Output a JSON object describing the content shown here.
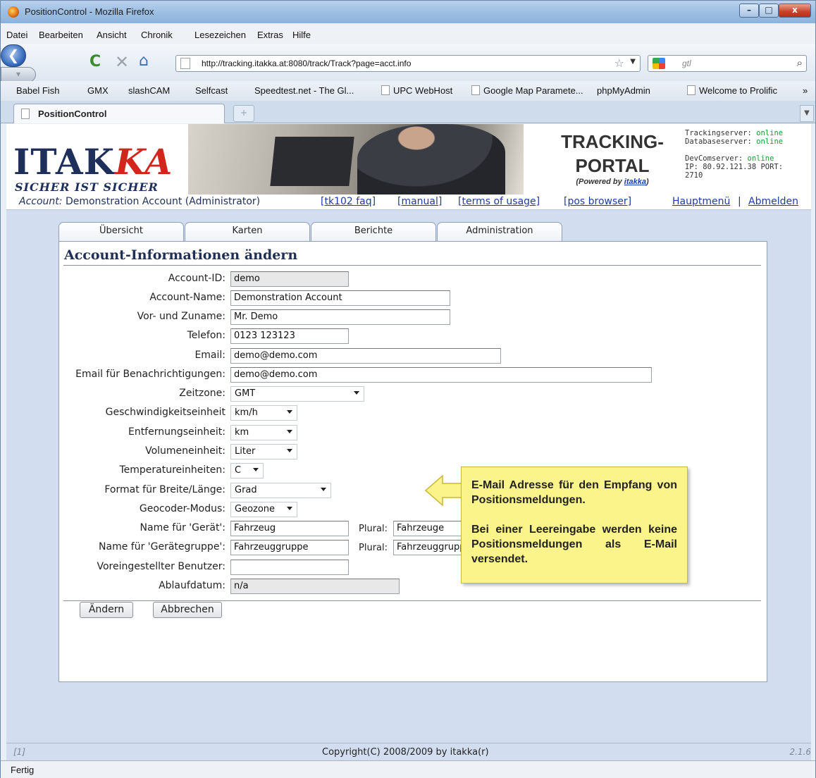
{
  "window": {
    "title": "PositionControl - Mozilla Firefox",
    "minimize_label": "–",
    "maximize_label": "□",
    "close_label": "x"
  },
  "menu": [
    "Datei",
    "Bearbeiten",
    "Ansicht",
    "Chronik",
    "Lesezeichen",
    "Extras",
    "Hilfe"
  ],
  "nav": {
    "back_glyph": "❮",
    "forward_glyph": "▾",
    "reload_glyph": "C",
    "stop_glyph": "✕",
    "home_glyph": "⌂",
    "url": "http://tracking.itakka.at:8080/track/Track?page=acct.info",
    "star_glyph": "☆",
    "search_text": "gtl"
  },
  "bookmarks": [
    "Babel Fish",
    "GMX",
    "slashCAM",
    "Selfcast",
    "Speedtest.net - The Gl...",
    "UPC WebHost",
    "Google Map Paramete...",
    "phpMyAdmin",
    "Welcome to Prolific",
    "»"
  ],
  "browser_tab": {
    "label": "PositionControl",
    "new_tab_glyph": "+"
  },
  "banner": {
    "logo_text_pre": "ITAK",
    "logo_text_red": "KA",
    "slogan": "SICHER IST SICHER",
    "portal_line1": "TRACKING-",
    "portal_line2": "PORTAL",
    "powered_prefix": "(Powered by ",
    "powered_link": "itakka",
    "powered_suffix": ")",
    "servers": {
      "tracking_label": "Trackingserver:",
      "tracking_status": "online",
      "database_label": "Databaseserver:",
      "database_status": "online",
      "devcom_label": "DevComserver:",
      "devcom_status": "online",
      "ip_line": "IP: 80.92.121.38 PORT:",
      "port": "2710"
    }
  },
  "account_bar": {
    "prefix": "Account:",
    "account": " Demonstration Account (Administrator)",
    "links": [
      "[tk102 faq]",
      "[manual]",
      "[terms of usage]",
      "[pos browser]"
    ],
    "main_menu": "Hauptmenü",
    "separator": "|",
    "logout": "Abmelden"
  },
  "tabs": [
    "Übersicht",
    "Karten",
    "Berichte",
    "Administration"
  ],
  "form": {
    "title": "Account-Informationen ändern",
    "fields": [
      {
        "label": "Account-ID:",
        "value": "demo"
      },
      {
        "label": "Account-Name:",
        "value": "Demonstration Account"
      },
      {
        "label": "Vor- und Zuname:",
        "value": "Mr. Demo"
      },
      {
        "label": "Telefon:",
        "value": "0123 123123"
      },
      {
        "label": "Email:",
        "value": "demo@demo.com"
      },
      {
        "label": "Email für Benachrichtigungen:",
        "value": "demo@demo.com"
      },
      {
        "label": "Zeitzone:",
        "value": "GMT"
      },
      {
        "label": "Geschwindigkeitseinheit",
        "value": "km/h"
      },
      {
        "label": "Entfernungseinheit:",
        "value": "km"
      },
      {
        "label": "Volumeneinheit:",
        "value": "Liter"
      },
      {
        "label": "Temperatureinheiten:",
        "value": "C"
      },
      {
        "label": "Format für Breite/Länge:",
        "value": "Grad"
      },
      {
        "label": "Geocoder-Modus:",
        "value": "Geozone"
      },
      {
        "label": "Name für 'Gerät':",
        "value": "Fahrzeug",
        "plural_label": "Plural:",
        "plural_value": "Fahrzeuge"
      },
      {
        "label": "Name für 'Gerätegruppe':",
        "value": "Fahrzeuggruppe",
        "plural_label": "Plural:",
        "plural_value": "Fahrzeuggruppen"
      },
      {
        "label": "Voreingestellter Benutzer:",
        "value": ""
      },
      {
        "label": "Ablaufdatum:",
        "value": "n/a"
      }
    ],
    "buttons": {
      "change": "Ändern",
      "cancel": "Abbrechen"
    }
  },
  "callout": {
    "line1": "E-Mail Adresse für den Empfang von Positionsmeldungen.",
    "line2": "Bei einer Leereingabe werden keine Positionsmeldungen als E-Mail versendet."
  },
  "footer": {
    "left": "[1]",
    "copyright": "Copyright(C) 2008/2009 by itakka(r)",
    "version": "2.1.6"
  },
  "status": "Fertig",
  "colors": {
    "online": "#1d9c2c",
    "logo_navy": "#1e2f5c",
    "logo_red": "#d2261d",
    "callout_bg": "#fbf48a"
  }
}
